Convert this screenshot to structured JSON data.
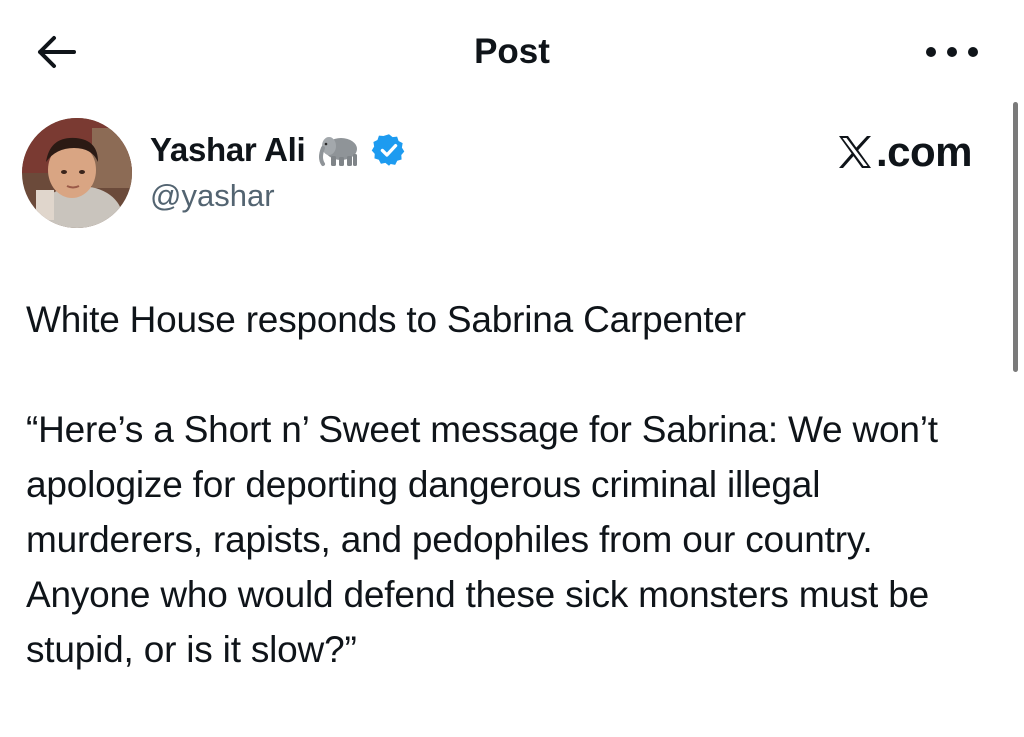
{
  "header": {
    "title": "Post",
    "back_icon": "arrow-left-icon",
    "more_icon": "more-horizontal-icon"
  },
  "author": {
    "display_name": "Yashar Ali",
    "handle": "@yashar",
    "name_emoji": "elephant-icon",
    "verified_icon": "verified-badge-icon",
    "verified_color": "#1d9bf0"
  },
  "watermark": {
    "text": ".com",
    "logo_icon": "x-logo-icon"
  },
  "post": {
    "line1": "White House responds to Sabrina Carpenter",
    "quote": "“Here’s a Short n’ Sweet message for Sabrina: We won’t apologize for deporting dangerous criminal illegal murderers, rapists, and pedophiles from our country. Anyone who would defend these sick monsters must be stupid, or is it slow?”"
  },
  "colors": {
    "text": "#0f1419",
    "secondary_text": "#536471",
    "background": "#ffffff"
  }
}
